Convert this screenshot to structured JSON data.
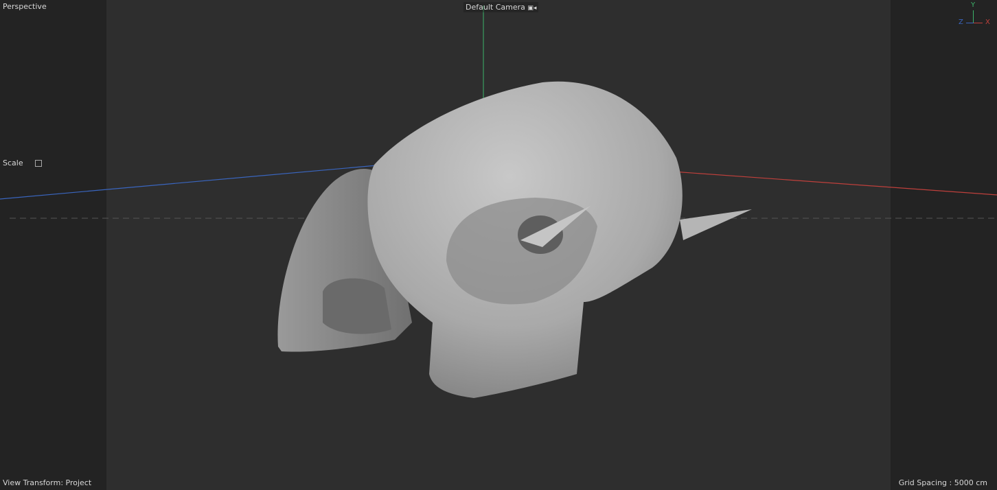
{
  "viewport": {
    "name": "Perspective",
    "camera": "Default Camera",
    "camera_icon": "camera-icon"
  },
  "hud": {
    "scale_label": "Scale",
    "scale_icon": "scale-toggle-icon"
  },
  "footer": {
    "view_transform": "View Transform: Project",
    "grid_spacing": "Grid Spacing : 5000 cm"
  },
  "axis_gizmo": {
    "y": "Y",
    "z": "Z",
    "x": "X"
  },
  "colors": {
    "x_axis": "#c0403c",
    "y_axis": "#3cb46a",
    "z_axis": "#3a66c0"
  }
}
